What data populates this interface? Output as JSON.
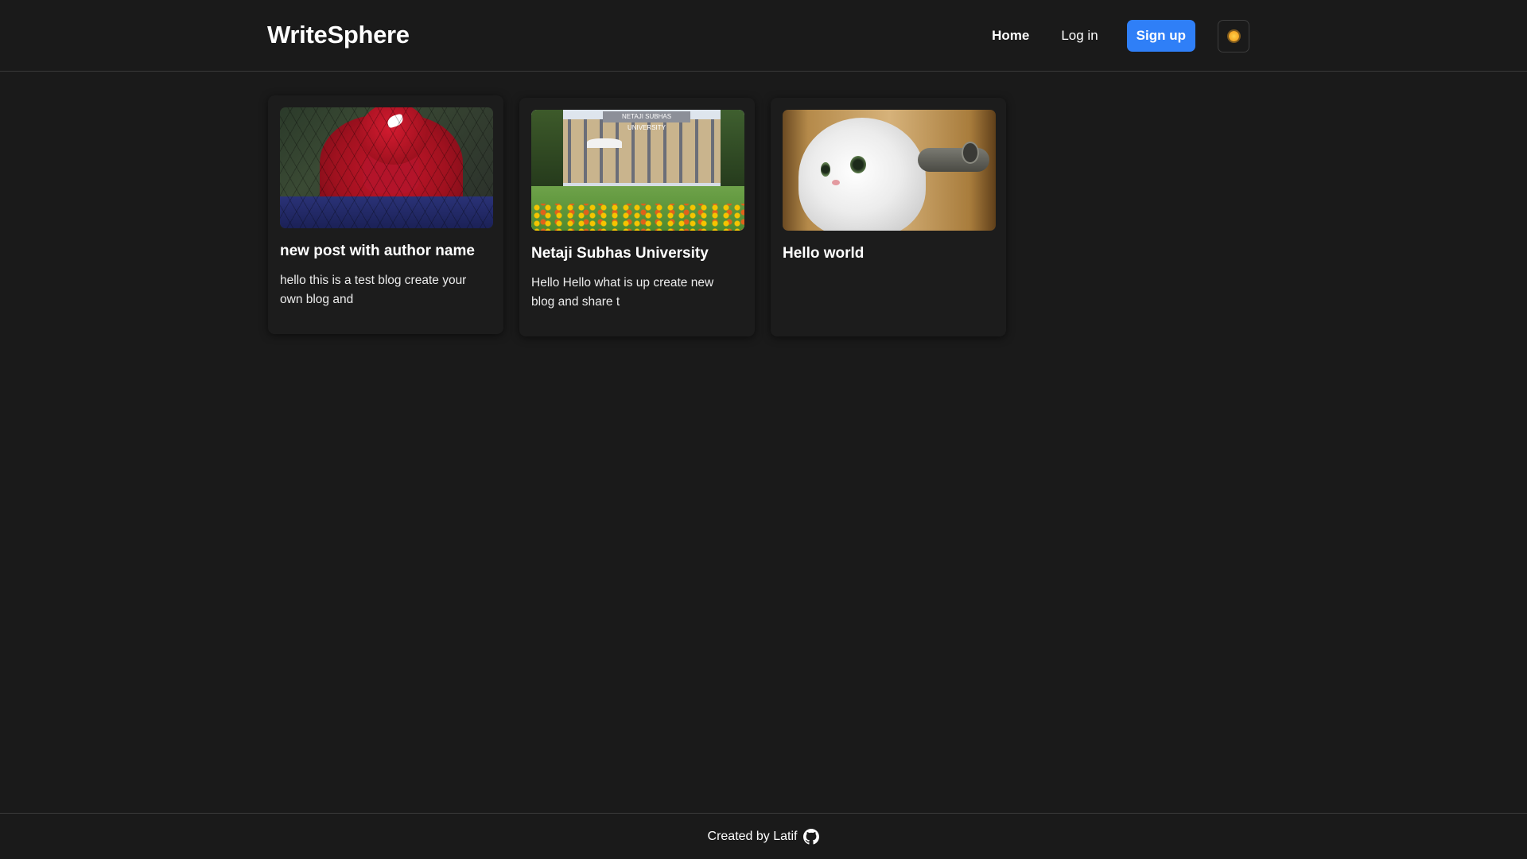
{
  "navbar": {
    "brand": "WriteSphere",
    "links": {
      "home": "Home",
      "login": "Log in",
      "signup": "Sign up"
    },
    "theme_toggle_icon": "sun-icon"
  },
  "posts": [
    {
      "title": "new post with author name",
      "excerpt": "hello this is a test blog create your own blog and",
      "image": "spider-man-image"
    },
    {
      "title": "Netaji Subhas University",
      "excerpt": "Hello Hello what is up create new blog and share t",
      "image": "university-image",
      "image_banner": "NETAJI SUBHAS UNIVERSITY"
    },
    {
      "title": "Hello world",
      "excerpt": "",
      "image": "cat-image"
    }
  ],
  "footer": {
    "text": "Created by Latif",
    "icon": "github-icon"
  },
  "colors": {
    "background": "#1a1a1a",
    "accent": "#2f7ff7",
    "text": "#ffffff"
  }
}
